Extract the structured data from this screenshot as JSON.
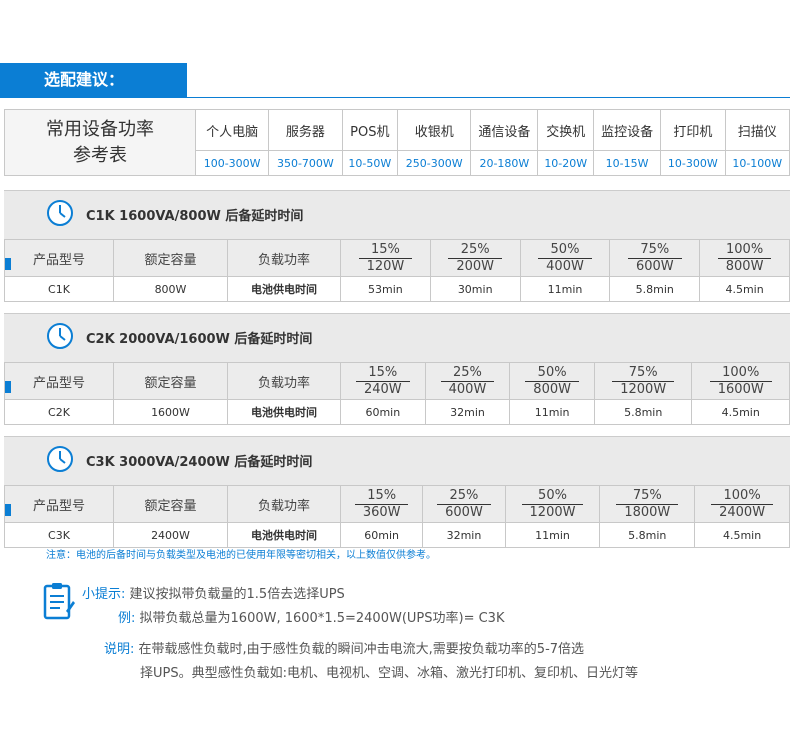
{
  "header": {
    "title": "选配建议："
  },
  "reference": {
    "title_line1": "常用设备功率",
    "title_line2": "参考表",
    "devices": [
      "个人电脑",
      "服务器",
      "POS机",
      "收银机",
      "通信设备",
      "交换机",
      "监控设备",
      "打印机",
      "扫描仪"
    ],
    "powers": [
      "100-300W",
      "350-700W",
      "10-50W",
      "250-300W",
      "20-180W",
      "10-20W",
      "10-15W",
      "10-300W",
      "10-100W"
    ]
  },
  "sections": [
    {
      "title": "C1K 1600VA/800W 后备延时时间",
      "col_model": "产品型号",
      "col_rated": "额定容量",
      "col_load": "负载功率",
      "loads": [
        {
          "pct": "15%",
          "w": "120W"
        },
        {
          "pct": "25%",
          "w": "200W"
        },
        {
          "pct": "50%",
          "w": "400W"
        },
        {
          "pct": "75%",
          "w": "600W"
        },
        {
          "pct": "100%",
          "w": "800W"
        }
      ],
      "model": "C1K",
      "rated": "800W",
      "label": "电池供电时间",
      "times": [
        "53min",
        "30min",
        "11min",
        "5.8min",
        "4.5min"
      ]
    },
    {
      "title": "C2K  2000VA/1600W 后备延时时间",
      "col_model": "产品型号",
      "col_rated": "额定容量",
      "col_load": "负载功率",
      "loads": [
        {
          "pct": "15%",
          "w": "240W"
        },
        {
          "pct": "25%",
          "w": "400W"
        },
        {
          "pct": "50%",
          "w": "800W"
        },
        {
          "pct": "75%",
          "w": "1200W"
        },
        {
          "pct": "100%",
          "w": "1600W"
        }
      ],
      "model": "C2K",
      "rated": "1600W",
      "label": "电池供电时间",
      "times": [
        "60min",
        "32min",
        "11min",
        "5.8min",
        "4.5min"
      ]
    },
    {
      "title": "C3K 3000VA/2400W 后备延时时间",
      "col_model": "产品型号",
      "col_rated": "额定容量",
      "col_load": "负载功率",
      "loads": [
        {
          "pct": "15%",
          "w": "360W"
        },
        {
          "pct": "25%",
          "w": "600W"
        },
        {
          "pct": "50%",
          "w": "1200W"
        },
        {
          "pct": "75%",
          "w": "1800W"
        },
        {
          "pct": "100%",
          "w": "2400W"
        }
      ],
      "model": "C3K",
      "rated": "2400W",
      "label": "电池供电时间",
      "times": [
        "60min",
        "32min",
        "11min",
        "5.8min",
        "4.5min"
      ]
    }
  ],
  "note": "注意：电池的后备时间与负载类型及电池的已使用年限等密切相关，以上数值仅供参考。",
  "tips": {
    "tip_label": "小提示:",
    "tip_text": "建议按拟带负载量的1.5倍去选择UPS",
    "example_label": "例:",
    "example_text": "拟带负载总量为1600W, 1600*1.5=2400W(UPS功率)= C3K",
    "explain_label": "说明:",
    "explain_line1": "在带载感性负载时,由于感性负载的瞬间冲击电流大,需要按负载功率的5-7倍选",
    "explain_line2": "择UPS。典型感性负载如:电机、电视机、空调、冰箱、激光打印机、复印机、日光灯等"
  },
  "colors": {
    "accent": "#0b7ed4"
  }
}
